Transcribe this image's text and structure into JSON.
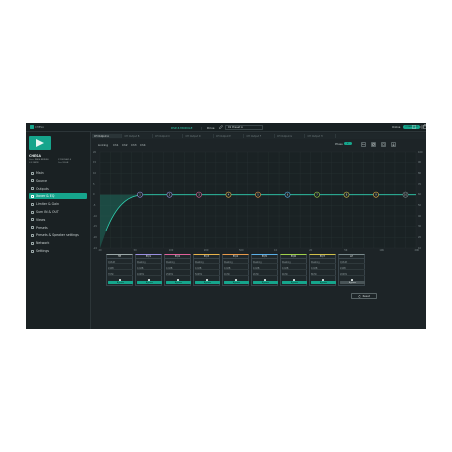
{
  "app": {
    "logo_text": "CHESA",
    "title": "DSP-6 MODULE",
    "title_sep": "|",
    "mode_label": "Drive",
    "edit_icon": "pencil-icon",
    "preset_label": "01 Preset A",
    "status_label": "Online",
    "status_badge": "CONNECTED",
    "accent_color": "#16a58c",
    "curve_color": "#2fd0b0"
  },
  "sidebar": {
    "device_name": "CHESA",
    "info": [
      {
        "k": "Name",
        "v": "DSP-6 MODULE"
      },
      {
        "k": "S/N",
        "v": "25378"
      },
      {
        "k": "IP",
        "v": "192.168.1.5"
      },
      {
        "k": "Firm",
        "v": "V1.0.8"
      }
    ],
    "items": [
      {
        "label": "Main",
        "icon": "home-icon"
      },
      {
        "label": "Source",
        "icon": "source-icon"
      },
      {
        "label": "Outputs",
        "icon": "output-icon"
      },
      {
        "label": "Xover & EQ",
        "icon": "eq-icon",
        "active": true
      },
      {
        "label": "Limiter & Gain",
        "icon": "limiter-icon"
      },
      {
        "label": "Sum IN & OUT",
        "icon": "sum-icon"
      },
      {
        "label": "Views",
        "icon": "views-icon"
      },
      {
        "label": "Presets",
        "icon": "presets-icon"
      },
      {
        "label": "Presets & Speaker settings",
        "icon": "speaker-icon"
      },
      {
        "label": "Network",
        "icon": "network-icon"
      },
      {
        "label": "Settings",
        "icon": "settings-icon"
      }
    ]
  },
  "tabs": [
    "CH Output A",
    "CH Output B",
    "CH Output C",
    "CH Output D",
    "CH Output E",
    "CH Output F",
    "CH Output G",
    "CH Output H"
  ],
  "selection": {
    "items": [
      "Linking",
      "Ch1",
      "Ch2",
      "Ch3",
      "Ch4"
    ],
    "phase_label": "Phase",
    "phase_badge": "0°"
  },
  "graph": {
    "y_left": [
      "20",
      "15",
      "10",
      "5",
      "0",
      "-5",
      "-10",
      "-15",
      "-20",
      "-24"
    ],
    "y_right": [
      "100",
      "90",
      "80",
      "70",
      "60",
      "50",
      "40",
      "30",
      "20",
      "10"
    ],
    "x_ticks": [
      "20",
      "50",
      "100",
      "200",
      "500",
      "1K",
      "2K",
      "5K",
      "10K",
      "20K"
    ],
    "markers": [
      "1",
      "2",
      "3",
      "4",
      "5",
      "6",
      "7",
      "8",
      "9",
      "10"
    ]
  },
  "columns": [
    {
      "head": "HP",
      "rows": [
        "Q-Butt",
        "24dB",
        "70Hz"
      ],
      "btn": "Bypass"
    },
    {
      "head": "EQ1",
      "rows": [
        "Peaking",
        "0.0dB",
        "100Hz"
      ],
      "btn": "Bypass"
    },
    {
      "head": "EQ2",
      "rows": [
        "Peaking",
        "0.0dB",
        "250Hz"
      ],
      "btn": "Bypass"
    },
    {
      "head": "EQ3",
      "rows": [
        "Peaking",
        "0.0dB",
        "500Hz"
      ],
      "btn": "Bypass"
    },
    {
      "head": "EQ4",
      "rows": [
        "Peaking",
        "0.0dB",
        "1KHz"
      ],
      "btn": "Bypass"
    },
    {
      "head": "EQ5",
      "rows": [
        "Peaking",
        "0.0dB",
        "2KHz"
      ],
      "btn": "Bypass"
    },
    {
      "head": "EQ6",
      "rows": [
        "Peaking",
        "0.0dB",
        "4KHz"
      ],
      "btn": "Bypass"
    },
    {
      "head": "EQ7",
      "rows": [
        "Peaking",
        "0.0dB",
        "8KHz"
      ],
      "btn": "Bypass"
    },
    {
      "head": "LP",
      "rows": [
        "Q-Butt",
        "24dB",
        "20KHz"
      ],
      "btn": "Bypass"
    }
  ],
  "reset_label": "Reset"
}
